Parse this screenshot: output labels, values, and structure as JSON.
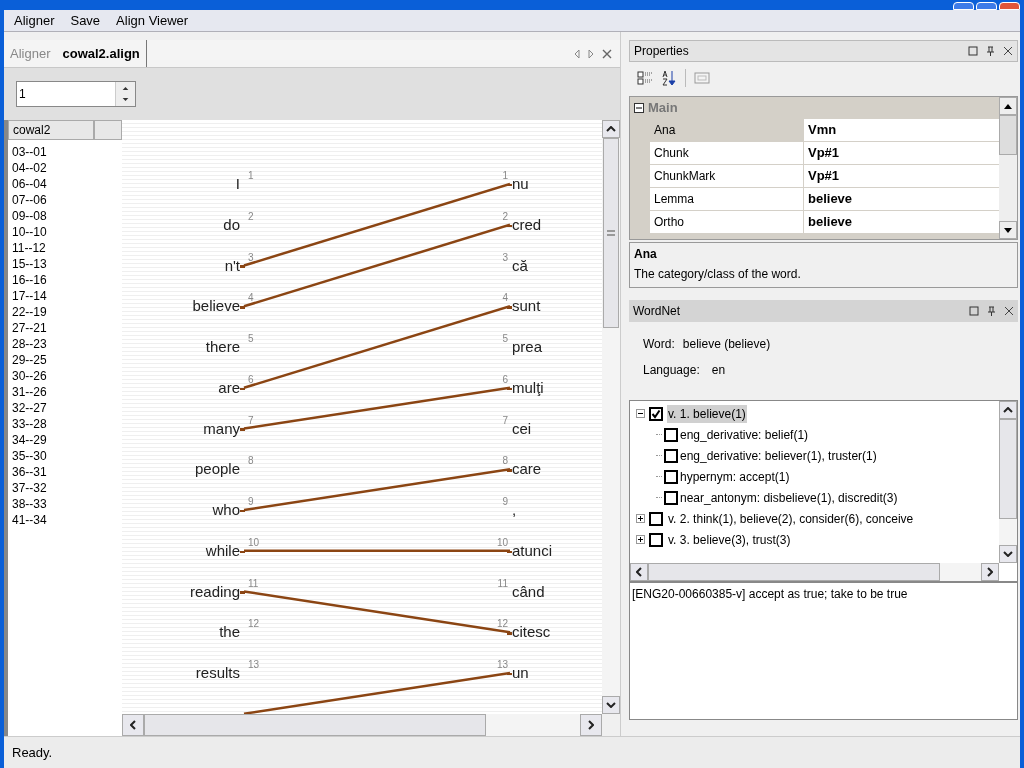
{
  "menu": [
    "Aligner",
    "Save",
    "Align Viewer"
  ],
  "tabs": [
    {
      "label": "Aligner",
      "selected": false
    },
    {
      "label": "cowal2.align",
      "selected": true
    }
  ],
  "spin_value": "1",
  "list": {
    "columns": [
      "cowal2"
    ],
    "items": [
      "03--01",
      "04--02",
      "06--04",
      "07--06",
      "09--08",
      "10--10",
      "11--12",
      "15--13",
      "16--16",
      "17--14",
      "22--19",
      "27--21",
      "28--23",
      "29--25",
      "30--26",
      "31--26",
      "32--27",
      "33--28",
      "34--29",
      "35--30",
      "36--31",
      "37--32",
      "38--33",
      "41--34"
    ]
  },
  "alignment": {
    "source": [
      {
        "word": "I",
        "index": "1",
        "aligned": false
      },
      {
        "word": "do",
        "index": "2",
        "aligned": false
      },
      {
        "word": "n't",
        "index": "3",
        "aligned": true
      },
      {
        "word": "believe",
        "index": "4",
        "aligned": true
      },
      {
        "word": "there",
        "index": "5",
        "aligned": false
      },
      {
        "word": "are",
        "index": "6",
        "aligned": true
      },
      {
        "word": "many",
        "index": "7",
        "aligned": true
      },
      {
        "word": "people",
        "index": "8",
        "aligned": false
      },
      {
        "word": "who",
        "index": "9",
        "aligned": true
      },
      {
        "word": "while",
        "index": "10",
        "aligned": true
      },
      {
        "word": "reading",
        "index": "11",
        "aligned": true
      },
      {
        "word": "the",
        "index": "12",
        "aligned": false
      },
      {
        "word": "results",
        "index": "13",
        "aligned": false
      }
    ],
    "target": [
      {
        "word": "nu",
        "index": "1",
        "aligned": true
      },
      {
        "word": "cred",
        "index": "2",
        "aligned": true
      },
      {
        "word": "că",
        "index": "3",
        "aligned": false
      },
      {
        "word": "sunt",
        "index": "4",
        "aligned": true
      },
      {
        "word": "prea",
        "index": "5",
        "aligned": false
      },
      {
        "word": "mulţi",
        "index": "6",
        "aligned": true
      },
      {
        "word": "cei",
        "index": "7",
        "aligned": false
      },
      {
        "word": "care",
        "index": "8",
        "aligned": true
      },
      {
        "word": ",",
        "index": "9",
        "aligned": false
      },
      {
        "word": "atunci",
        "index": "10",
        "aligned": true
      },
      {
        "word": "când",
        "index": "11",
        "aligned": false
      },
      {
        "word": "citesc",
        "index": "12",
        "aligned": true
      },
      {
        "word": "un",
        "index": "13",
        "aligned": true
      }
    ]
  },
  "status_bar": "Ready.",
  "properties": {
    "title": "Properties",
    "category": "Main",
    "rows": [
      {
        "name": "Ana",
        "value": "Vmn",
        "selected": true
      },
      {
        "name": "Chunk",
        "value": "Vp#1",
        "selected": false
      },
      {
        "name": "ChunkMark",
        "value": "Vp#1",
        "selected": false
      },
      {
        "name": "Lemma",
        "value": "believe",
        "selected": false
      },
      {
        "name": "Ortho",
        "value": "believe",
        "selected": false
      }
    ],
    "help_title": "Ana",
    "help_text": "The category/class of the word."
  },
  "wordnet": {
    "title": "WordNet",
    "word_label": "Word:",
    "word": "believe (believe)",
    "language_label": "Language:",
    "language": "en",
    "tree": [
      {
        "label": "v.  1. believe(1)",
        "checked": true,
        "expanded": true,
        "selected": true,
        "children": [
          {
            "label": "eng_derivative: belief(1)",
            "checked": false
          },
          {
            "label": "eng_derivative: believer(1), truster(1)",
            "checked": false
          },
          {
            "label": "hypernym: accept(1)",
            "checked": false
          },
          {
            "label": "near_antonym: disbelieve(1), discredit(3)",
            "checked": false
          }
        ]
      },
      {
        "label": "v.  2. think(1), believe(2), consider(6), conceive",
        "checked": false,
        "expanded": false,
        "selected": false
      },
      {
        "label": "v.  3. believe(3), trust(3)",
        "checked": false,
        "expanded": false,
        "selected": false
      }
    ],
    "definition": "[ENG20-00660385-v] accept as true; take to be true"
  }
}
